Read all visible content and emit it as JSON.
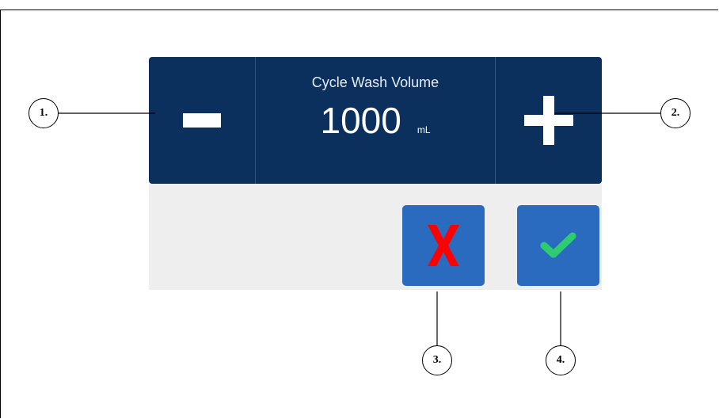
{
  "panel": {
    "title": "Cycle Wash Volume",
    "value": "1000",
    "unit": "mL",
    "decrement_icon": "minus-icon",
    "increment_icon": "plus-icon"
  },
  "actions": {
    "cancel_icon": "x-icon",
    "confirm_icon": "check-icon"
  },
  "callouts": [
    "1.",
    "2.",
    "3.",
    "4."
  ],
  "colors": {
    "panel_bg": "#0c305d",
    "button_bg": "#2b6bbf",
    "cancel_red": "#ff0000",
    "confirm_green": "#2ecc71",
    "bar_bg": "#eeeeee"
  }
}
